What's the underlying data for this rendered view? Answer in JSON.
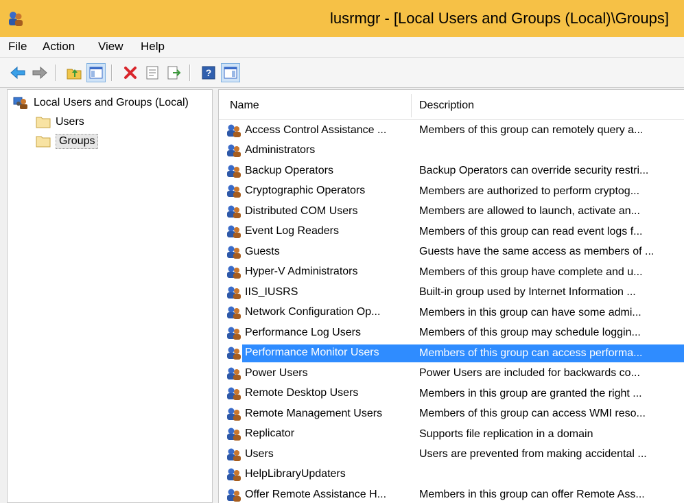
{
  "window": {
    "title": "lusrmgr - [Local Users and Groups (Local)\\Groups]",
    "titlebar_color": "#f6c146"
  },
  "menu": [
    "File",
    "Action",
    "View",
    "Help"
  ],
  "toolbar": {
    "buttons": [
      "back-arrow-icon",
      "forward-arrow-icon",
      "up-folder-icon",
      "show-hide-console-tree-icon",
      "delete-icon",
      "properties-icon",
      "export-list-icon",
      "help-icon",
      "show-action-pane-icon"
    ]
  },
  "tree": {
    "root": "Local Users and Groups (Local)",
    "children": [
      "Users",
      "Groups"
    ],
    "selected": "Groups"
  },
  "list": {
    "columns": [
      "Name",
      "Description"
    ],
    "selection_color": "#2f8cff",
    "rows": [
      {
        "name": "Access Control Assistance ...",
        "description": "Members of this group can remotely query a..."
      },
      {
        "name": "Administrators",
        "description": ""
      },
      {
        "name": "Backup Operators",
        "description": "Backup Operators can override security restri..."
      },
      {
        "name": "Cryptographic Operators",
        "description": "Members are authorized to perform cryptog..."
      },
      {
        "name": "Distributed COM Users",
        "description": "Members are allowed to launch, activate an..."
      },
      {
        "name": "Event Log Readers",
        "description": "Members of this group can read event logs f..."
      },
      {
        "name": "Guests",
        "description": "Guests have the same access as members of ..."
      },
      {
        "name": "Hyper-V Administrators",
        "description": "Members of this group have complete and u..."
      },
      {
        "name": "IIS_IUSRS",
        "description": "Built-in group used by Internet Information ..."
      },
      {
        "name": "Network Configuration Op...",
        "description": "Members in this group can have some admi..."
      },
      {
        "name": "Performance Log Users",
        "description": "Members of this group may schedule loggin..."
      },
      {
        "name": "Performance Monitor Users",
        "description": "Members of this group can access performa..."
      },
      {
        "name": "Power Users",
        "description": "Power Users are included for backwards co..."
      },
      {
        "name": "Remote Desktop Users",
        "description": "Members in this group are granted the right ..."
      },
      {
        "name": "Remote Management Users",
        "description": "Members of this group can access WMI reso..."
      },
      {
        "name": "Replicator",
        "description": "Supports file replication in a domain"
      },
      {
        "name": "Users",
        "description": "Users are prevented from making accidental ..."
      },
      {
        "name": "HelpLibraryUpdaters",
        "description": ""
      },
      {
        "name": "Offer Remote Assistance H...",
        "description": "Members in this group can offer Remote Ass..."
      }
    ],
    "selected_index": 11
  }
}
